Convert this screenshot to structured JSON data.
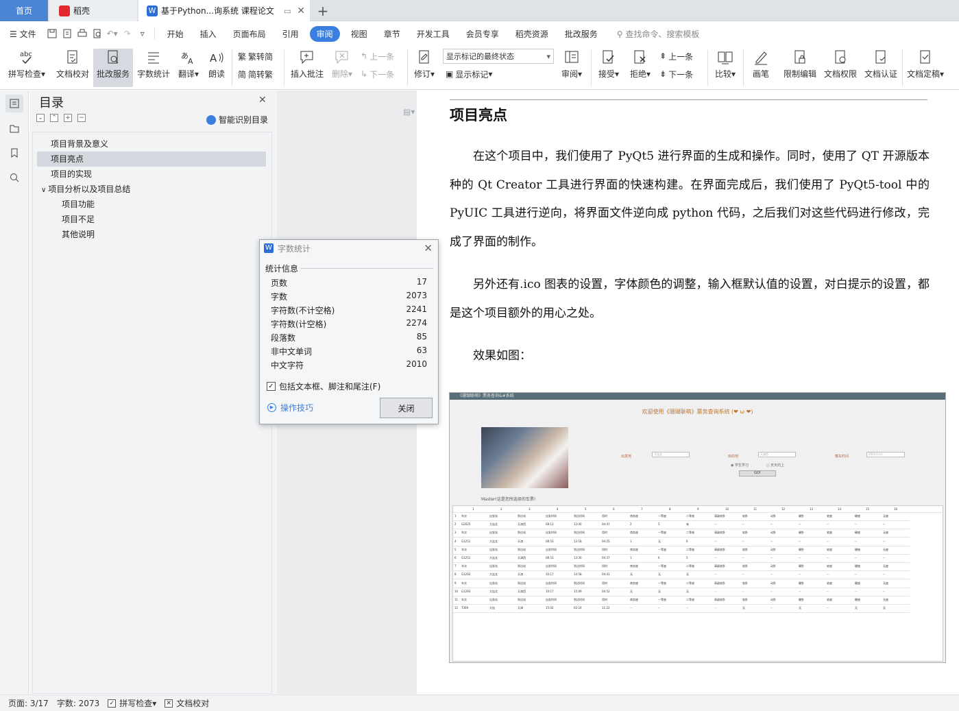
{
  "tabs": {
    "home": "首页",
    "daoke": "稻壳",
    "doc": "基于Python...询系统 课程论文"
  },
  "menu": {
    "file": "文件",
    "items": [
      "开始",
      "插入",
      "页面布局",
      "引用",
      "审阅",
      "视图",
      "章节",
      "开发工具",
      "会员专享",
      "稻壳资源",
      "批改服务"
    ],
    "active": "审阅",
    "search_placeholder": "查找命令、搜索模板"
  },
  "ribbon": {
    "spell": "拼写检查",
    "proof": "文档校对",
    "correct": "批改服务",
    "wordcount": "字数统计",
    "translate": "翻译",
    "read": "朗读",
    "to_trad": "繁转简",
    "to_simp": "简转繁",
    "insert_comment": "插入批注",
    "delete": "删除",
    "prev_comment": "上一条",
    "next_comment": "下一条",
    "revise": "修订",
    "mark_state": "显示标记的最终状态",
    "show_marks": "显示标记",
    "review": "审阅",
    "accept": "接受",
    "reject": "拒绝",
    "prev": "上一条",
    "next": "下一条",
    "compare": "比较",
    "pen": "画笔",
    "restrict": "限制编辑",
    "permission": "文档权限",
    "certify": "文档认证",
    "finalize": "文档定稿"
  },
  "toc": {
    "title": "目录",
    "smart": "智能识别目录",
    "items": [
      {
        "label": "项目背景及意义"
      },
      {
        "label": "项目亮点"
      },
      {
        "label": "项目的实现"
      },
      {
        "label": "项目分析以及项目总结"
      },
      {
        "label": "项目功能"
      },
      {
        "label": "项目不足"
      },
      {
        "label": "其他说明"
      }
    ]
  },
  "doc": {
    "heading": "项目亮点",
    "p1": "在这个项目中，我们使用了 PyQt5 进行界面的生成和操作。同时，使用了 QT 开源版本种的 Qt Creator 工具进行界面的快速构建。在界面完成后，我们使用了 PyQt5-tool 中的 PyUIC 工具进行逆向，将界面文件逆向成 python 代码，之后我们对这些代码进行修改，完成了界面的制作。",
    "p2": "另外还有.ico 图表的设置，字体颜色的调整，输入框默认值的设置，对白提示的设置，都是这个项目额外的用心之处。",
    "p3": "效果如图：",
    "shot": {
      "title": "《珊瑚联萌》票务查询&#系统",
      "headline": "欢迎使用《珊瑚联萌》票务查询系统",
      "caption": "Master!这是您所选择的车票!",
      "from_label": "出发地",
      "from_value": "大连北",
      "to_label": "目的地",
      "to_value": "天津西",
      "date_label": "乘车时间",
      "date_value": "2021/1/11",
      "opt1": "学生学习",
      "opt2": "天天向上",
      "go": "GO!",
      "cols": [
        "1",
        "2",
        "3",
        "4",
        "5",
        "6",
        "7",
        "8",
        "9",
        "10",
        "11",
        "12",
        "13",
        "14",
        "15",
        "16"
      ],
      "rows": [
        [
          "车次",
          "出发站",
          "到达站",
          "出发时间",
          "到达时间",
          "用时",
          "商务座",
          "一等座",
          "二等座",
          "高级软卧",
          "软卧",
          "动卧",
          "硬卧",
          "软座",
          "硬座",
          "无座"
        ],
        [
          "G2625",
          "大连北",
          "天津西",
          "08:13",
          "13:00",
          "04:47",
          "2",
          "5",
          "有",
          "--",
          "--",
          "--",
          "--",
          "--",
          "--",
          "--"
        ],
        [
          "车次",
          "出发站",
          "到达站",
          "出发时间",
          "到达时间",
          "用时",
          "商务座",
          "一等座",
          "二等座",
          "高级软卧",
          "软卧",
          "动卧",
          "硬卧",
          "软座",
          "硬座",
          "无座"
        ],
        [
          "G1251",
          "大连北",
          "天津",
          "08:53",
          "13:18",
          "04:25",
          "1",
          "无",
          "6",
          "--",
          "--",
          "--",
          "--",
          "--",
          "--",
          "--"
        ],
        [
          "车次",
          "出发站",
          "到达站",
          "出发时间",
          "到达时间",
          "用时",
          "商务座",
          "一等座",
          "二等座",
          "高级软卧",
          "软卧",
          "动卧",
          "硬卧",
          "软座",
          "硬座",
          "无座"
        ],
        [
          "G1251",
          "大连北",
          "天津西",
          "08:53",
          "13:30",
          "04:37",
          "1",
          "6",
          "5",
          "--",
          "--",
          "--",
          "--",
          "--",
          "--",
          "--"
        ],
        [
          "车次",
          "出发站",
          "到达站",
          "出发时间",
          "到达时间",
          "用时",
          "商务座",
          "一等座",
          "二等座",
          "高级软卧",
          "软卧",
          "动卧",
          "硬卧",
          "软座",
          "硬座",
          "无座"
        ],
        [
          "G1293",
          "大连北",
          "天津",
          "10:17",
          "14:58",
          "04:41",
          "无",
          "无",
          "无",
          "--",
          "--",
          "--",
          "--",
          "--",
          "--",
          "--"
        ],
        [
          "车次",
          "出发站",
          "到达站",
          "出发时间",
          "到达时间",
          "用时",
          "商务座",
          "一等座",
          "二等座",
          "高级软卧",
          "软卧",
          "动卧",
          "硬卧",
          "软座",
          "硬座",
          "无座"
        ],
        [
          "G1293",
          "大连北",
          "天津西",
          "10:17",
          "15:09",
          "04:52",
          "无",
          "无",
          "无",
          "--",
          "--",
          "--",
          "--",
          "--",
          "--",
          "--"
        ],
        [
          "车次",
          "出发站",
          "到达站",
          "出发时间",
          "到达时间",
          "用时",
          "商务座",
          "一等座",
          "二等座",
          "高级软卧",
          "软卧",
          "动卧",
          "硬卧",
          "软座",
          "硬座",
          "无座"
        ],
        [
          "T369",
          "大连",
          "天津",
          "15:02",
          "02:24",
          "11:22",
          "--",
          "--",
          "--",
          "--",
          "无",
          "--",
          "无",
          "--",
          "无",
          "无"
        ]
      ]
    }
  },
  "dialog": {
    "title": "字数统计",
    "section": "统计信息",
    "stats": [
      {
        "label": "页数",
        "value": "17"
      },
      {
        "label": "字数",
        "value": "2073"
      },
      {
        "label": "字符数(不计空格)",
        "value": "2241"
      },
      {
        "label": "字符数(计空格)",
        "value": "2274"
      },
      {
        "label": "段落数",
        "value": "85"
      },
      {
        "label": "非中文单词",
        "value": "63"
      },
      {
        "label": "中文字符",
        "value": "2010"
      }
    ],
    "checkbox": "包括文本框、脚注和尾注(F)",
    "tips": "操作技巧",
    "close": "关闭"
  },
  "status": {
    "page": "页面: 3/17",
    "words": "字数: 2073",
    "spell": "拼写检查",
    "proof": "文档校对"
  },
  "colors": {
    "accent": "#3a7ee0",
    "home_tab": "#4a84d4",
    "wps_red": "#e0282e"
  }
}
